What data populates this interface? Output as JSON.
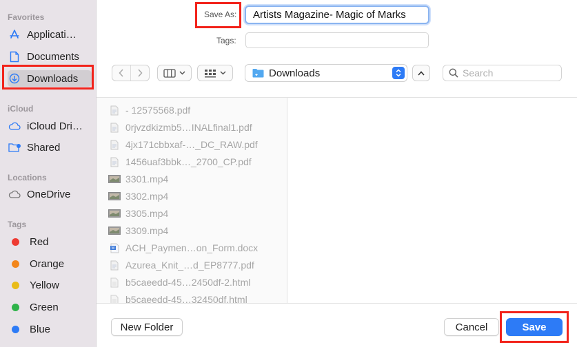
{
  "sidebar": {
    "favorites_header": "Favorites",
    "favorites": [
      {
        "label": "Applicati…",
        "icon": "applications-icon"
      },
      {
        "label": "Documents",
        "icon": "document-icon"
      },
      {
        "label": "Downloads",
        "icon": "downloads-icon"
      }
    ],
    "icloud_header": "iCloud",
    "icloud": [
      {
        "label": "iCloud Dri…",
        "icon": "cloud-icon"
      },
      {
        "label": "Shared",
        "icon": "shared-folder-icon"
      }
    ],
    "locations_header": "Locations",
    "locations": [
      {
        "label": "OneDrive",
        "icon": "cloud-drive-icon"
      }
    ],
    "tags_header": "Tags",
    "tags": [
      {
        "label": "Red",
        "color": "#ee3b33"
      },
      {
        "label": "Orange",
        "color": "#f2861b"
      },
      {
        "label": "Yellow",
        "color": "#e9bc18"
      },
      {
        "label": "Green",
        "color": "#2fb34a"
      },
      {
        "label": "Blue",
        "color": "#2d7bf6"
      }
    ]
  },
  "form": {
    "save_as_label": "Save As:",
    "save_as_value": "Artists Magazine- Magic of Marks",
    "tags_label": "Tags:"
  },
  "toolbar": {
    "location": "Downloads",
    "search_placeholder": "Search"
  },
  "files": [
    {
      "name": "- 12575568.pdf",
      "type": "doc"
    },
    {
      "name": "0rjvzdkizmb5…INALfinal1.pdf",
      "type": "doc"
    },
    {
      "name": "4jx171cbbxaf-…_DC_RAW.pdf",
      "type": "doc"
    },
    {
      "name": "1456uaf3bbk…_2700_CP.pdf",
      "type": "doc"
    },
    {
      "name": "3301.mp4",
      "type": "video"
    },
    {
      "name": "3302.mp4",
      "type": "video"
    },
    {
      "name": "3305.mp4",
      "type": "video"
    },
    {
      "name": "3309.mp4",
      "type": "video"
    },
    {
      "name": "ACH_Paymen…on_Form.docx",
      "type": "word"
    },
    {
      "name": "Azurea_Knit_…d_EP8777.pdf",
      "type": "doc"
    },
    {
      "name": "b5caeedd-45…2450df-2.html",
      "type": "blank"
    },
    {
      "name": "b5caeedd-45…32450df.html",
      "type": "blank"
    }
  ],
  "buttons": {
    "new_folder": "New Folder",
    "cancel": "Cancel",
    "save": "Save"
  },
  "colors": {
    "accent": "#2d7bf6",
    "highlight": "#f2231b",
    "sidebar_bg": "#e8e3e8"
  }
}
